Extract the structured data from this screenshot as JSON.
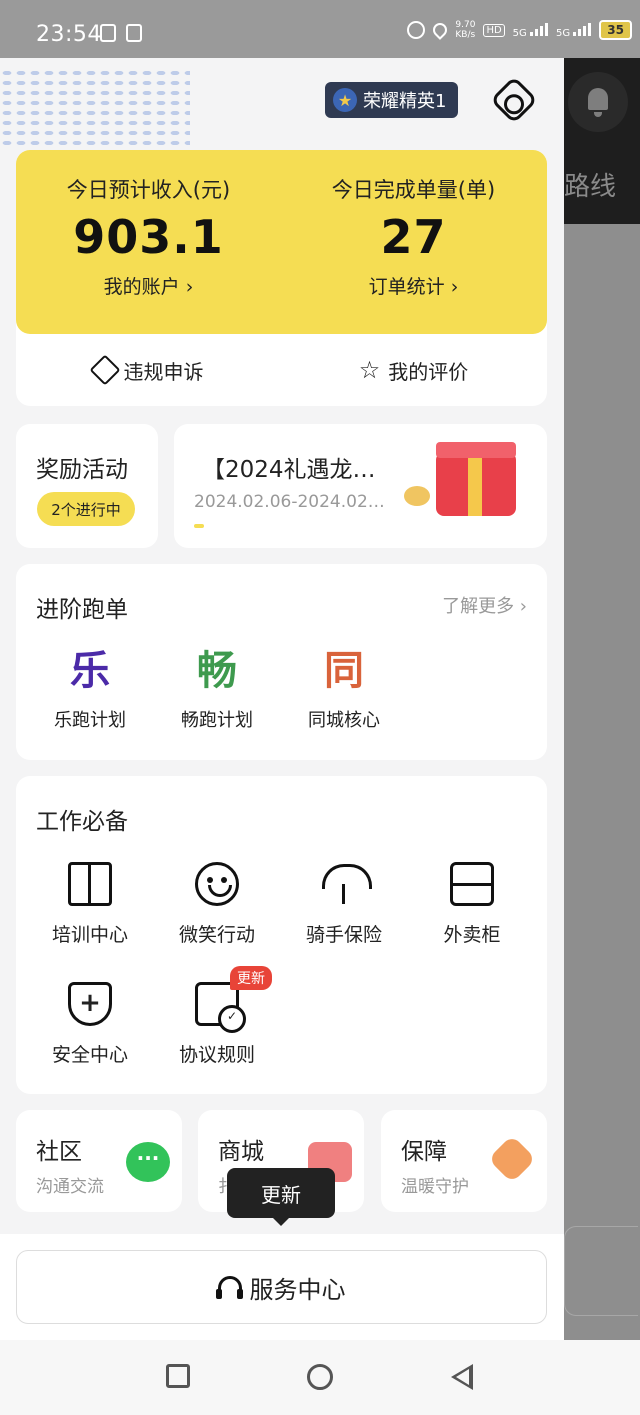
{
  "status_bar": {
    "time": "23:54",
    "net_speed_value": "9.70",
    "net_speed_unit": "KB/s",
    "hd_label": "HD",
    "signal1": "5G",
    "signal2": "5G",
    "battery": "35"
  },
  "header": {
    "rank_badge": "荣耀精英1",
    "fish_decoration": "fish-pattern"
  },
  "overlay": {
    "route_text": "路线"
  },
  "income": {
    "today_income_label": "今日预计收入(元)",
    "today_income_value": "903.1",
    "account_link": "我的账户 ›",
    "today_orders_label": "今日完成单量(单)",
    "today_orders_value": "27",
    "order_stats_link": "订单统计 ›",
    "appeal_label": "违规申诉",
    "rating_label": "我的评价"
  },
  "rewards": {
    "title": "奖励活动",
    "status_pill": "2个进行中",
    "promo_title": "【2024礼遇龙…",
    "promo_date": "2024.02.06-2024.02…"
  },
  "advanced": {
    "title": "进阶跑单",
    "more": "了解更多 ›",
    "items": [
      {
        "char": "乐",
        "label": "乐跑计划",
        "color": "#4b2aa8"
      },
      {
        "char": "畅",
        "label": "畅跑计划",
        "color": "#3e9a4e"
      },
      {
        "char": "同",
        "label": "同城核心",
        "color": "#d9633b"
      }
    ]
  },
  "work": {
    "title": "工作必备",
    "tools": [
      {
        "label": "培训中心",
        "icon": "book-icon"
      },
      {
        "label": "微笑行动",
        "icon": "smile-icon"
      },
      {
        "label": "骑手保险",
        "icon": "umbrella-icon"
      },
      {
        "label": "外卖柜",
        "icon": "cabinet-icon"
      },
      {
        "label": "安全中心",
        "icon": "shield-plus-icon"
      },
      {
        "label": "协议规则",
        "icon": "document-check-icon"
      }
    ],
    "new_badge": "更新"
  },
  "bottom_cards": [
    {
      "title": "社区",
      "sub": "沟通交流",
      "icon": "chat-bubble-icon"
    },
    {
      "title": "商城",
      "sub": "扌",
      "icon": "gift-shop-icon"
    },
    {
      "title": "保障",
      "sub": "温暖守护",
      "icon": "heart-icon"
    }
  ],
  "tooltip": "更新",
  "service": {
    "label": "服务中心"
  },
  "colors": {
    "accent_yellow": "#f5dd53",
    "badge_red": "#e84438",
    "rank_badge_bg": "#2f3a52"
  }
}
